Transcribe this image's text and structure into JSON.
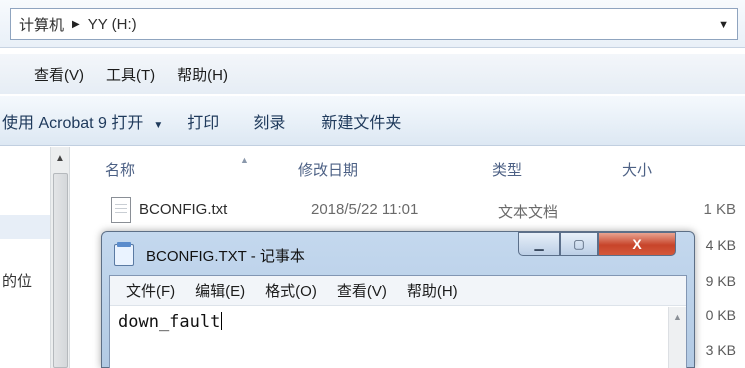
{
  "address_bar": {
    "crumb_computer": "计算机",
    "crumb_drive": "YY (H:)"
  },
  "menu": {
    "view": "查看(V)",
    "tools": "工具(T)",
    "help": "帮助(H)"
  },
  "toolbar": {
    "open_with": "使用 Acrobat 9 打开",
    "print": "打印",
    "burn": "刻录",
    "new_folder": "新建文件夹"
  },
  "columns": {
    "name": "名称",
    "modified": "修改日期",
    "type": "类型",
    "size": "大小"
  },
  "files": [
    {
      "name": "BCONFIG.txt",
      "modified": "2018/5/22 11:01",
      "type": "文本文档",
      "size": "1 KB"
    }
  ],
  "size_column_fragments": [
    "4 KB",
    "9 KB",
    "0 KB",
    "3 KB"
  ],
  "nav_fragment": "的位",
  "notepad": {
    "title": "BCONFIG.TXT - 记事本",
    "menu": {
      "file": "文件(F)",
      "edit": "编辑(E)",
      "format": "格式(O)",
      "view": "查看(V)",
      "help": "帮助(H)"
    },
    "content": "down_fault",
    "close_glyph": "X"
  }
}
